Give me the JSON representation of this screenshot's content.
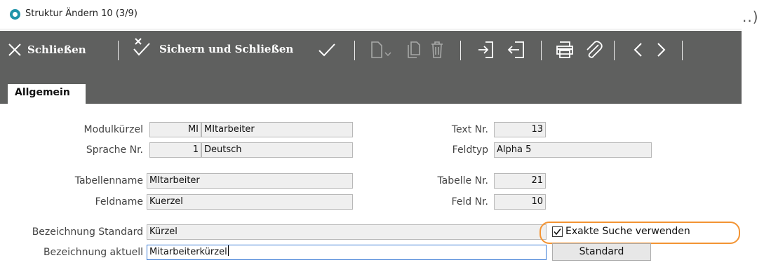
{
  "window": {
    "title": "Struktur Ändern 10 (3/9)",
    "overflow": "..)"
  },
  "toolbar": {
    "close_label": "Schließen",
    "save_close_label": "Sichern und Schließen"
  },
  "tabs": [
    {
      "label": "Allgemein"
    }
  ],
  "form": {
    "modulkuerzel": {
      "label": "Modulkürzel",
      "code": "MI",
      "value": "MItarbeiter"
    },
    "sprache": {
      "label": "Sprache Nr.",
      "code": "1",
      "value": "Deutsch"
    },
    "text_nr": {
      "label": "Text Nr.",
      "value": "13"
    },
    "feldtyp": {
      "label": "Feldtyp",
      "value": "Alpha 5"
    },
    "tabellenname": {
      "label": "Tabellenname",
      "value": "MItarbeiter"
    },
    "tabelle_nr": {
      "label": "Tabelle Nr.",
      "value": "21"
    },
    "feldname": {
      "label": "Feldname",
      "value": "Kuerzel"
    },
    "feld_nr": {
      "label": "Feld Nr.",
      "value": "10"
    },
    "bez_standard": {
      "label": "Bezeichnung Standard",
      "value": "Kürzel"
    },
    "bez_aktuell": {
      "label": "Bezeichnung aktuell",
      "value": "Mitarbeiterkürzel"
    },
    "exakte_suche": {
      "label": "Exakte Suche verwenden",
      "checked": true
    },
    "standard_button": "Standard"
  },
  "colors": {
    "toolbar_bg": "#5f605f",
    "highlight": "#f39433",
    "field_bg": "#efefef",
    "focus_border": "#3a7bd5"
  },
  "icons": [
    "app-icon",
    "close-icon",
    "save-close-icon",
    "check-icon",
    "new-doc-icon",
    "copy-icon",
    "delete-icon",
    "import-icon",
    "export-icon",
    "print-icon",
    "attach-icon",
    "prev-icon",
    "next-icon"
  ]
}
